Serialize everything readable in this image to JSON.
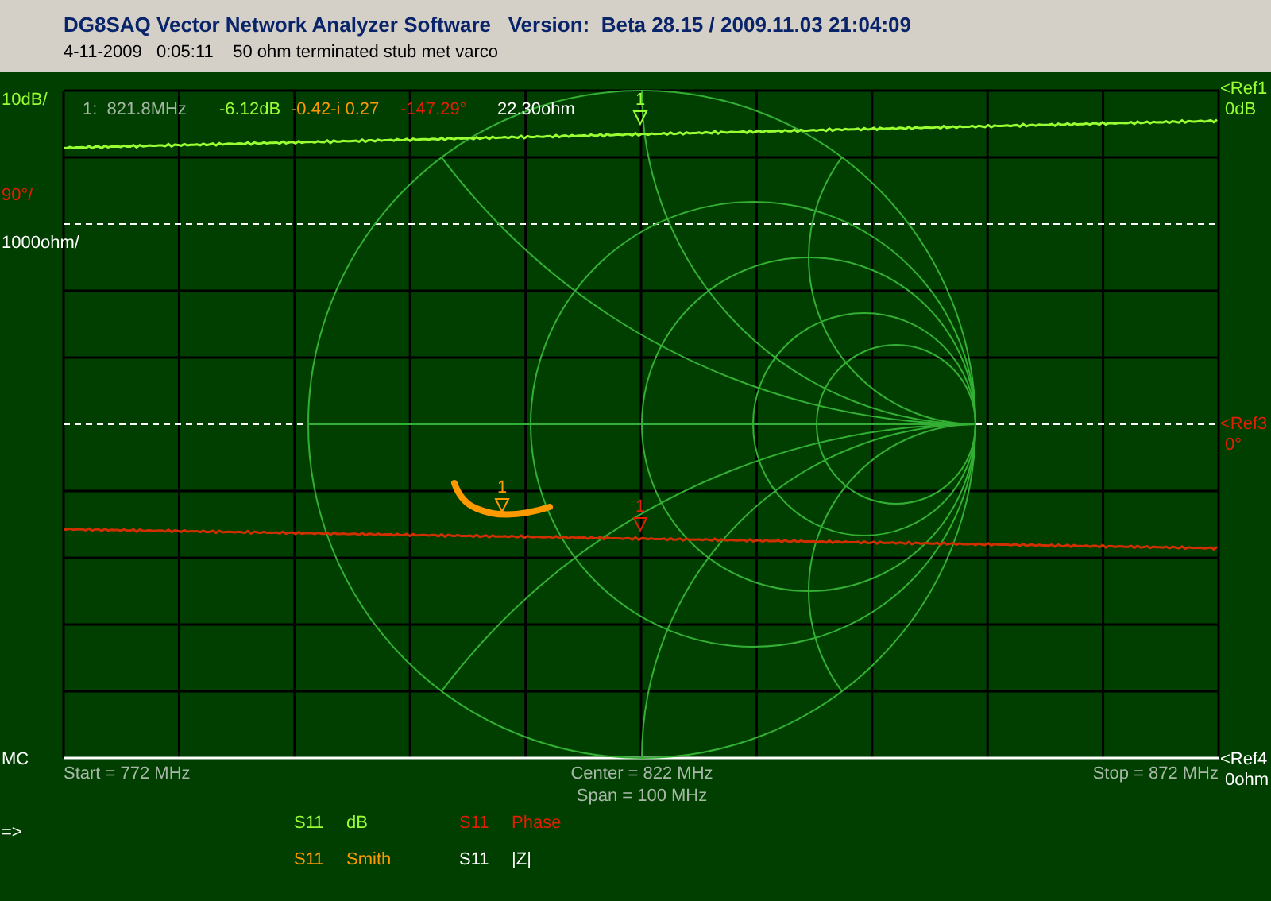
{
  "window": {
    "title": "DG8SAQ Vector Network Analyzer Software   Version:  Beta 28.15 / 2009.11.03 21:04:09",
    "subtitle": "4-11-2009   0:05:11    50 ohm terminated stub met varco"
  },
  "scale_labels": [
    {
      "text": "10dB/",
      "color": "#99ff33"
    },
    {
      "text": "90°/",
      "color": "#e02000"
    },
    {
      "text": "1000ohm/",
      "color": "#ffffff"
    },
    {
      "text": "MC",
      "color": "#ffffff"
    },
    {
      "text": "=>",
      "color": "#ffffff"
    }
  ],
  "marker_readout": [
    {
      "text": "1:  821.8MHz",
      "color": "#a8b8a8"
    },
    {
      "text": "-6.12dB",
      "color": "#99ff33"
    },
    {
      "text": "-0.42-i 0.27",
      "color": "#ff9900"
    },
    {
      "text": "-147.29°",
      "color": "#e02000"
    },
    {
      "text": "22.30ohm",
      "color": "#ffffff"
    }
  ],
  "reference_labels": [
    {
      "name": "<Ref1",
      "value": "0dB",
      "color": "#99ff33"
    },
    {
      "name": "<Ref3",
      "value": "0°",
      "color": "#e02000"
    },
    {
      "name": "<Ref4",
      "value": "0ohm",
      "color": "#ffffff"
    }
  ],
  "markers": [
    {
      "label": "1",
      "color": "#99ff33"
    },
    {
      "label": "1",
      "color": "#ff9900"
    },
    {
      "label": "1",
      "color": "#e02000"
    }
  ],
  "frequency_axis": {
    "start": "Start = 772 MHz",
    "center": "Center = 822 MHz",
    "span": "Span = 100 MHz",
    "stop": "Stop = 872 MHz"
  },
  "legend": [
    {
      "parameter": "S11",
      "format": "dB",
      "color": "#99ff33"
    },
    {
      "parameter": "S11",
      "format": "Phase",
      "color": "#e02000"
    },
    {
      "parameter": "S11",
      "format": "Smith",
      "color": "#ff9900"
    },
    {
      "parameter": "S11",
      "format": "|Z|",
      "color": "#ffffff"
    }
  ]
}
